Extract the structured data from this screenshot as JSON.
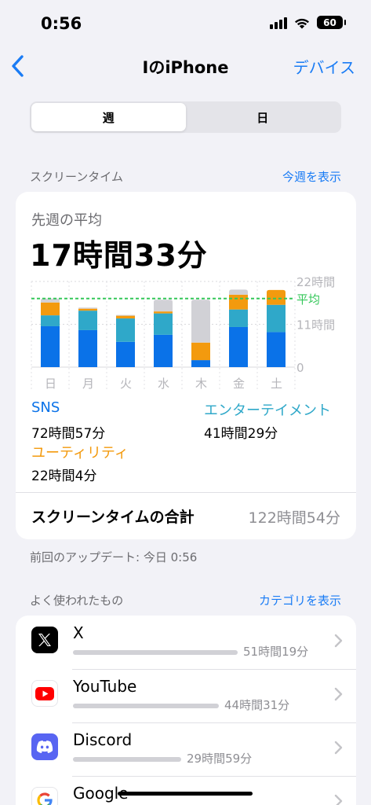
{
  "status_bar": {
    "time": "0:56",
    "battery": "60"
  },
  "nav": {
    "back_icon": "chevron-left-icon",
    "title": "IのiPhone",
    "right_label": "デバイス"
  },
  "segmented": {
    "options": [
      "週",
      "日"
    ],
    "selected": "週"
  },
  "screen_time_section": {
    "label": "スクリーンタイム",
    "link": "今週を表示"
  },
  "summary": {
    "average_label": "先週の平均",
    "average_value": "17時間33分",
    "categories": [
      {
        "name": "SNS",
        "time": "72時間57分",
        "color": "#0a72e8"
      },
      {
        "name": "エンターテイメント",
        "time": "41時間29分",
        "color": "#2fa8c9"
      },
      {
        "name": "ユーティリティ",
        "time": "22時間4分",
        "color": "#f39a0e"
      }
    ],
    "total_label": "スクリーンタイムの合計",
    "total_value": "122時間54分"
  },
  "chart_data": {
    "type": "bar",
    "stacked": true,
    "categories": [
      "日",
      "月",
      "火",
      "水",
      "木",
      "金",
      "土"
    ],
    "y_unit": "hours",
    "ylim": [
      0,
      22
    ],
    "y_ticks": [
      "0",
      "11時間",
      "22時間"
    ],
    "average_label": "平均",
    "average_value": 17.6,
    "series": [
      {
        "name": "SNS",
        "color": "#0a72e8",
        "values": [
          10.5,
          9.5,
          6.5,
          8.3,
          1.8,
          10.3,
          9.0
        ]
      },
      {
        "name": "エンターテイメント",
        "color": "#2fa8c9",
        "values": [
          2.8,
          5.0,
          6.0,
          5.5,
          0,
          4.5,
          7.0
        ]
      },
      {
        "name": "ユーティリティ",
        "color": "#f39a0e",
        "values": [
          3.3,
          0.5,
          0.7,
          0.5,
          4.5,
          3.8,
          3.8
        ]
      },
      {
        "color": "#d1d1d6",
        "values": [
          1.0,
          0.3,
          0.2,
          3.0,
          11.0,
          1.3,
          0
        ]
      }
    ],
    "grid": true
  },
  "update_note": "前回のアップデート: 今日 0:56",
  "most_used_section": {
    "label": "よく使われたもの",
    "link": "カテゴリを表示"
  },
  "apps": [
    {
      "name": "X",
      "time": "51時間19分",
      "icon": "x-logo-icon",
      "bar_fraction": 1.0
    },
    {
      "name": "YouTube",
      "time": "44時間31分",
      "icon": "youtube-logo-icon",
      "bar_fraction": 0.87
    },
    {
      "name": "Discord",
      "time": "29時間59分",
      "icon": "discord-logo-icon",
      "bar_fraction": 0.58
    },
    {
      "name": "Google",
      "time": "",
      "icon": "google-logo-icon"
    }
  ]
}
